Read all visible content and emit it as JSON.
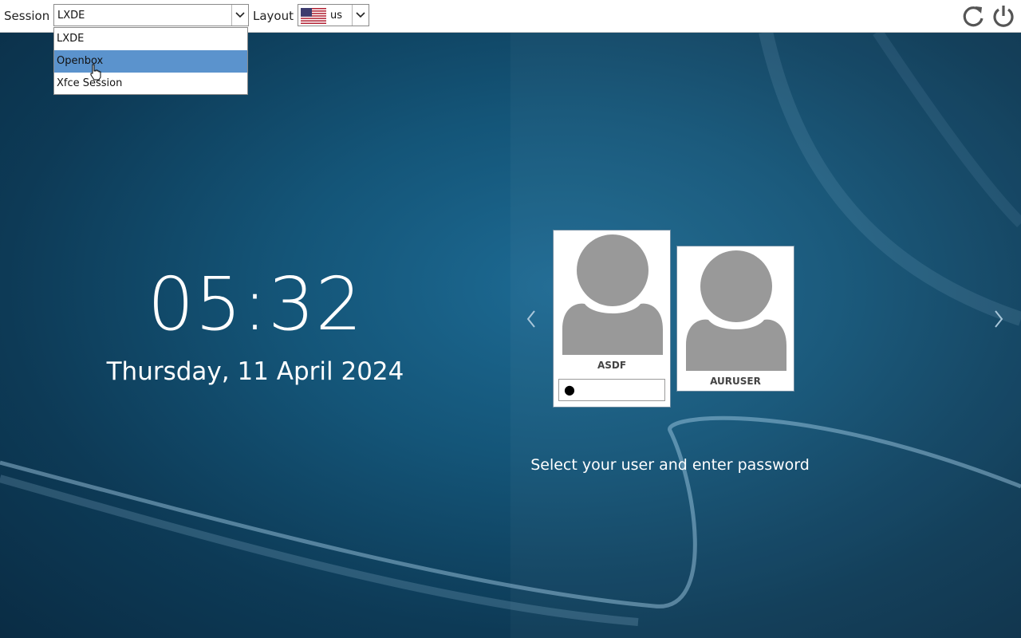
{
  "topbar": {
    "session_label": "Session",
    "session_value": "LXDE",
    "session_options": [
      "LXDE",
      "Openbox",
      "Xfce Session"
    ],
    "session_highlighted": "Openbox",
    "layout_label": "Layout",
    "layout_value": "us"
  },
  "clock": {
    "time": "05:32",
    "date": "Thursday, 11 April 2024"
  },
  "users": [
    {
      "name": "ASDF",
      "password_mask": "●"
    },
    {
      "name": "AURUSER"
    }
  ],
  "hint": "Select your user and enter password",
  "colors": {
    "highlight": "#5b93cd",
    "background": "#145578"
  },
  "icons": [
    "chevron-down-icon",
    "us-flag-icon",
    "restart-icon",
    "power-icon",
    "chevron-left-icon",
    "chevron-right-icon",
    "user-avatar-icon"
  ]
}
